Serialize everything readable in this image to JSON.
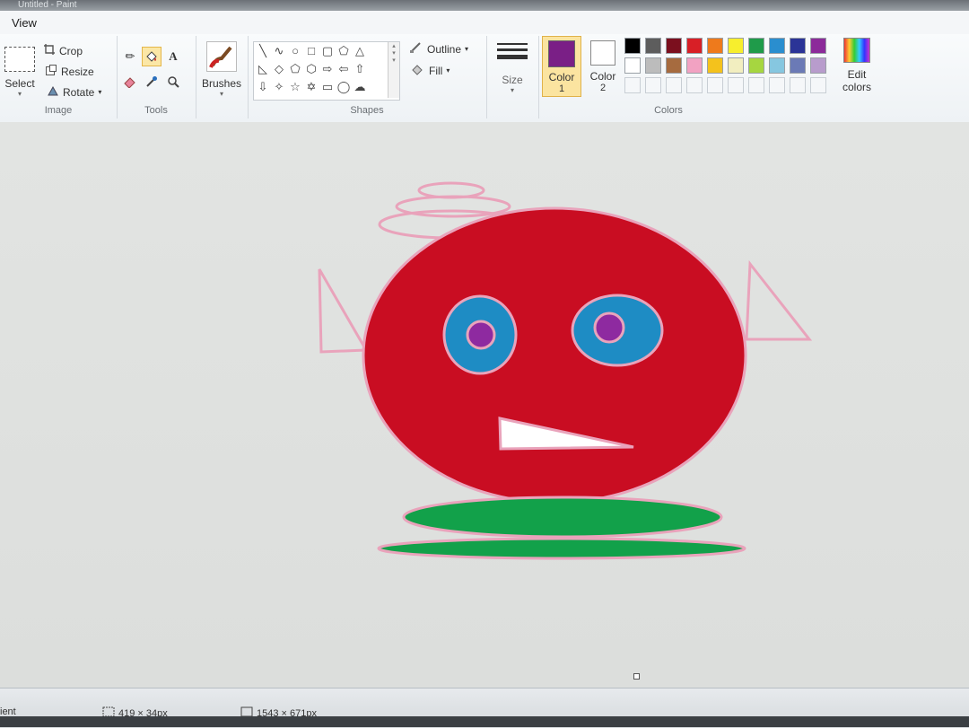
{
  "app": {
    "title": "Untitled - Paint"
  },
  "menu": {
    "view_tab": "View"
  },
  "ribbon": {
    "image": {
      "select_label": "Select",
      "crop_label": "Crop",
      "resize_label": "Resize",
      "rotate_label": "Rotate",
      "group_label": "Image"
    },
    "tools": {
      "group_label": "Tools"
    },
    "brushes": {
      "label": "Brushes"
    },
    "shapes": {
      "outline_label": "Outline",
      "fill_label": "Fill",
      "group_label": "Shapes"
    },
    "size": {
      "label": "Size"
    },
    "colors": {
      "color1_label": "Color",
      "color1_num": "1",
      "color2_label": "Color",
      "color2_num": "2",
      "edit_label": "Edit",
      "edit_label2": "colors",
      "group_label": "Colors",
      "color1_value": "#7a1f86",
      "color2_value": "#ffffff",
      "palette_row1": [
        "#000000",
        "#5d5d5d",
        "#7b0f1e",
        "#d81f26",
        "#ee7a1c",
        "#f7ee2d",
        "#1f9b4a",
        "#2a8ecf",
        "#2b3497",
        "#8c2b9a"
      ],
      "palette_row2": [
        "#ffffff",
        "#bcbcbc",
        "#a66b3f",
        "#f2a2c2",
        "#f4c21c",
        "#f2eec0",
        "#a6d640",
        "#86c7e0",
        "#6b7ab6",
        "#b89ccc"
      ]
    }
  },
  "drawing": {
    "face_color": "#c90d22",
    "outline_color": "#e9a3bb",
    "eye_color": "#1e8cc4",
    "pupil_color": "#8e2aa0",
    "base_color": "#12a14a"
  },
  "status": {
    "left_text": "ient",
    "selection_size": "419 × 34px",
    "canvas_size": "1543 × 671px"
  }
}
